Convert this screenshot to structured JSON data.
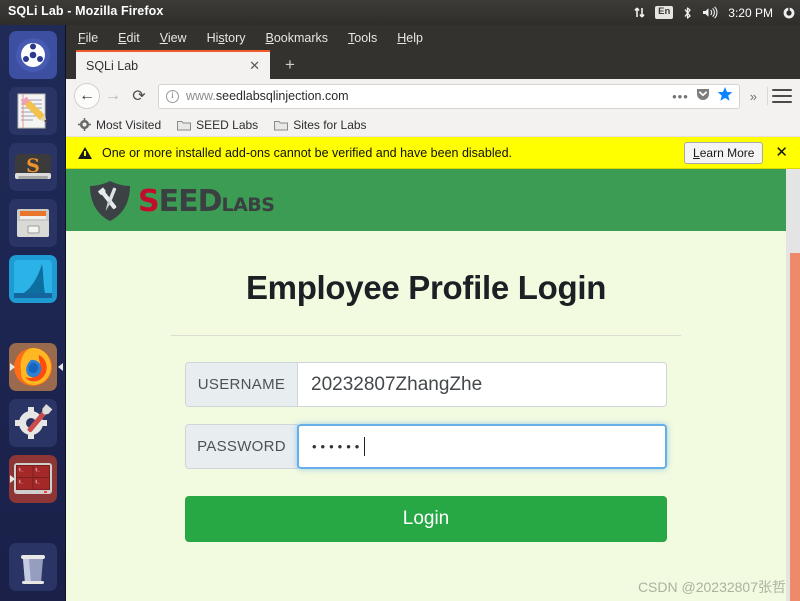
{
  "window": {
    "title": "SQLi Lab - Mozilla Firefox"
  },
  "tray": {
    "network_icon": "network-up-down-icon",
    "keyboard_layout": "En",
    "bluetooth_icon": "bluetooth-icon",
    "volume_icon": "volume-icon",
    "clock": "3:20 PM",
    "session_icon": "gear-power-icon"
  },
  "launcher": {
    "items": [
      {
        "name": "ubuntu-dash",
        "label": "Ubuntu Dash"
      },
      {
        "name": "text-editor",
        "label": "Text Editor"
      },
      {
        "name": "sublime-text",
        "label": "Sublime Text"
      },
      {
        "name": "files",
        "label": "Files"
      },
      {
        "name": "wireshark",
        "label": "Wireshark"
      },
      {
        "name": "firefox",
        "label": "Firefox"
      },
      {
        "name": "settings",
        "label": "System Settings"
      },
      {
        "name": "terminal",
        "label": "Terminator"
      },
      {
        "name": "trash",
        "label": "Trash"
      }
    ]
  },
  "menubar": {
    "items": [
      {
        "pre": "",
        "key": "F",
        "post": "ile"
      },
      {
        "pre": "",
        "key": "E",
        "post": "dit"
      },
      {
        "pre": "",
        "key": "V",
        "post": "iew"
      },
      {
        "pre": "Hi",
        "key": "s",
        "post": "tory"
      },
      {
        "pre": "",
        "key": "B",
        "post": "ookmarks"
      },
      {
        "pre": "",
        "key": "T",
        "post": "ools"
      },
      {
        "pre": "",
        "key": "H",
        "post": "elp"
      }
    ]
  },
  "tabs": {
    "active_label": "SQLi Lab",
    "close_glyph": "✕",
    "newtab_glyph": "+"
  },
  "nav": {
    "back_glyph": "←",
    "forward_glyph": "→",
    "reload_glyph": "⟳",
    "url_scheme": "www.",
    "url_domain": "seedlabsqlinjection.com",
    "page_actions_glyph": "•••",
    "overflow_glyph": "»"
  },
  "bookmarks": {
    "items": [
      {
        "icon": "star-settings-icon",
        "label": "Most Visited"
      },
      {
        "icon": "folder-icon",
        "label": "SEED Labs"
      },
      {
        "icon": "folder-icon",
        "label": "Sites for Labs"
      }
    ]
  },
  "notification": {
    "message": "One or more installed add-ons cannot be verified and have been disabled.",
    "button_pre": "",
    "button_key": "L",
    "button_post": "earn More",
    "close_glyph": "✕"
  },
  "page": {
    "logo": {
      "seed_first": "S",
      "seed_rest": "EED",
      "labs": "LABS"
    },
    "title": "Employee Profile Login",
    "fields": [
      {
        "label": "USERNAME",
        "value": "20232807ZhangZhe",
        "focused": false,
        "masked": false
      },
      {
        "label": "PASSWORD",
        "value": "••••••",
        "focused": true,
        "masked": true
      }
    ],
    "login_label": "Login",
    "watermark": "CSDN @20232807张哲"
  },
  "colors": {
    "header_green": "#3d9c54",
    "page_bg": "#f2fadf",
    "button_green": "#28a745",
    "notif_yellow": "#ffff00",
    "focus_blue": "#66afe9",
    "tab_accent": "#f05a28"
  }
}
